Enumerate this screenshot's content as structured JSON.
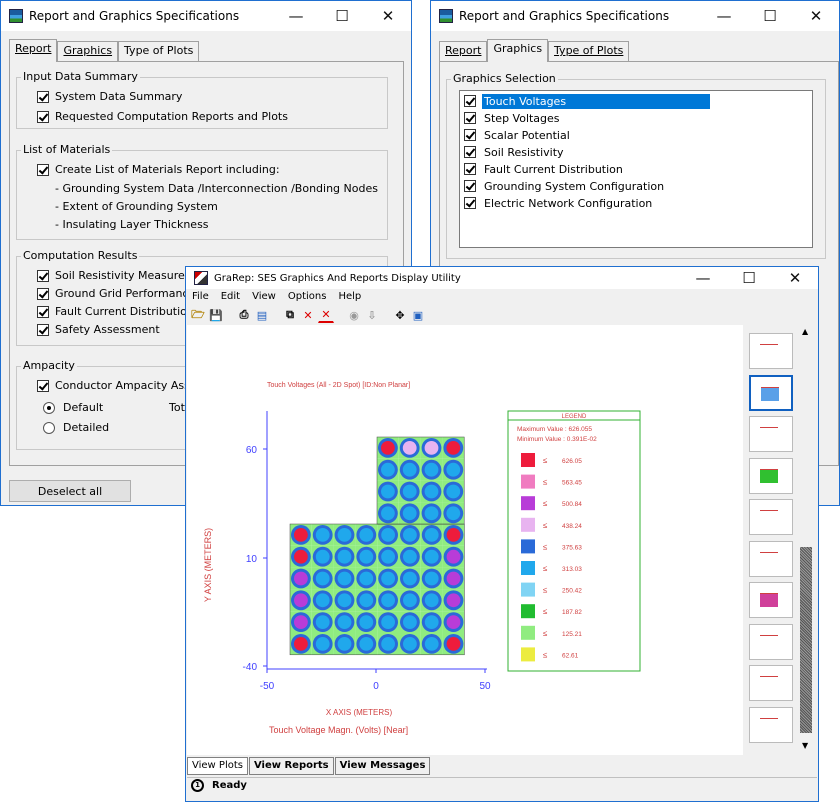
{
  "win1": {
    "title": "Report and Graphics Specifications",
    "tabs": [
      "Report",
      "Graphics",
      "Type of Plots"
    ],
    "input_group": {
      "label": "Input Data Summary",
      "items": [
        "System Data Summary",
        "Requested Computation Reports and Plots"
      ]
    },
    "materials_group": {
      "label": "List of Materials",
      "main": "Create List of Materials Report including:",
      "subs": [
        "- Grounding System Data /Interconnection /Bonding Nodes",
        "- Extent of Grounding System",
        "- Insulating Layer Thickness"
      ]
    },
    "computation_group": {
      "label": "Computation Results",
      "items": [
        "Soil Resistivity Measurement",
        "Ground Grid Performance",
        "Fault Current Distribution",
        "Safety Assessment"
      ]
    },
    "ampacity_group": {
      "label": "Ampacity",
      "item": "Conductor Ampacity Assess",
      "radio_default": "Default",
      "radio_detailed": "Detailed",
      "tot_label": "Tot"
    },
    "deselect_button": "Deselect all"
  },
  "win2": {
    "title": "Report and Graphics Specifications",
    "tabs": [
      "Report",
      "Graphics",
      "Type of Plots"
    ],
    "group_label": "Graphics Selection",
    "items": [
      "Touch Voltages",
      "Step Voltages",
      "Scalar Potential",
      "Soil Resistivity",
      "Fault Current Distribution",
      "Grounding System Configuration",
      "Electric Network Configuration"
    ]
  },
  "win3": {
    "title": "GraRep: SES Graphics And Reports Display Utility",
    "menu": [
      "File",
      "Edit",
      "View",
      "Options",
      "Help"
    ],
    "bottom_tabs": [
      "View Plots",
      "View Reports",
      "View Messages"
    ],
    "status": "Ready"
  },
  "chart_data": {
    "type": "heatmap",
    "title": "Touch Voltages (All - 2D Spot) [ID:Non Planar]",
    "xlabel": "X AXIS  (METERS)",
    "ylabel": "Y AXIS  (METERS)",
    "subtitle": "Touch Voltage Magn. (Volts) [Near]",
    "x_ticks": [
      "-50",
      "0",
      "50"
    ],
    "y_ticks": [
      "60",
      "10",
      "-40"
    ],
    "legend": {
      "title": "LEGEND",
      "max": "Maximum Value :   626.055",
      "min": "Minimum Value :  0.391E-02",
      "entries": [
        {
          "value": "626.05",
          "color": "#ee1c3c"
        },
        {
          "value": "563.45",
          "color": "#f07cc0"
        },
        {
          "value": "500.84",
          "color": "#b83cd8"
        },
        {
          "value": "438.24",
          "color": "#e8b4f0"
        },
        {
          "value": "375.63",
          "color": "#2a6ad8"
        },
        {
          "value": "313.03",
          "color": "#20a8ec"
        },
        {
          "value": "250.42",
          "color": "#80d4f4"
        },
        {
          "value": "187.82",
          "color": "#20bc30"
        },
        {
          "value": "125.21",
          "color": "#90ec80"
        },
        {
          "value": "62.61",
          "color": "#ecec40"
        }
      ]
    }
  }
}
